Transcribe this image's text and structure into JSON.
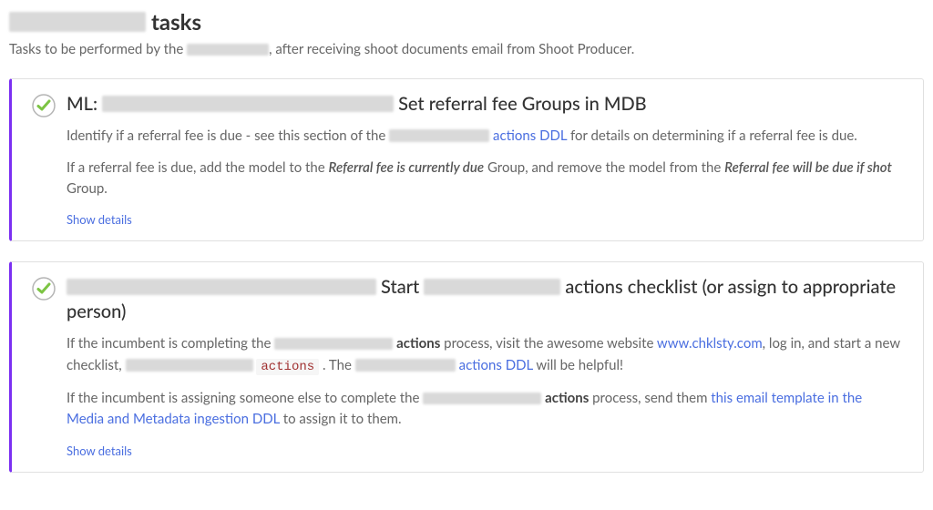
{
  "header": {
    "title_suffix": "tasks",
    "subtitle_prefix": "Tasks to be performed by the ",
    "subtitle_suffix": ", after receiving shoot documents email from Shoot Producer."
  },
  "tasks": [
    {
      "title_prefix": "ML: ",
      "title_suffix": " Set referral fee Groups in MDB",
      "p1_a": "Identify if a referral fee is due - see this section of the ",
      "p1_link": "actions DDL",
      "p1_b": " for details on determining if a referral fee is due.",
      "p2_a": "If a referral fee is due, add the model to the ",
      "p2_em1": "Referral fee is currently due",
      "p2_b": " Group, and remove the model from the ",
      "p2_em2": "Referral fee will be due if shot",
      "p2_c": " Group.",
      "show_details": "Show details"
    },
    {
      "title_mid": " Start ",
      "title_suffix": " actions checklist (or assign to appropriate person)",
      "p1_a": "If the incumbent is completing the ",
      "p1_bold": "actions",
      "p1_b": " process, visit the awesome website ",
      "p1_link1": "www.chklsty.com",
      "p1_c": ", log in, and start a new checklist, ",
      "p1_code": "actions",
      "p1_d": " . The ",
      "p1_link2": "actions DDL",
      "p1_e": " will be helpful!",
      "p2_a": "If the incumbent is assigning someone else to complete the ",
      "p2_bold": "actions",
      "p2_b": " process, send them ",
      "p2_link": "this email template in the Media and Metadata ingestion DDL",
      "p2_c": " to assign it to them.",
      "show_details": "Show details"
    }
  ]
}
